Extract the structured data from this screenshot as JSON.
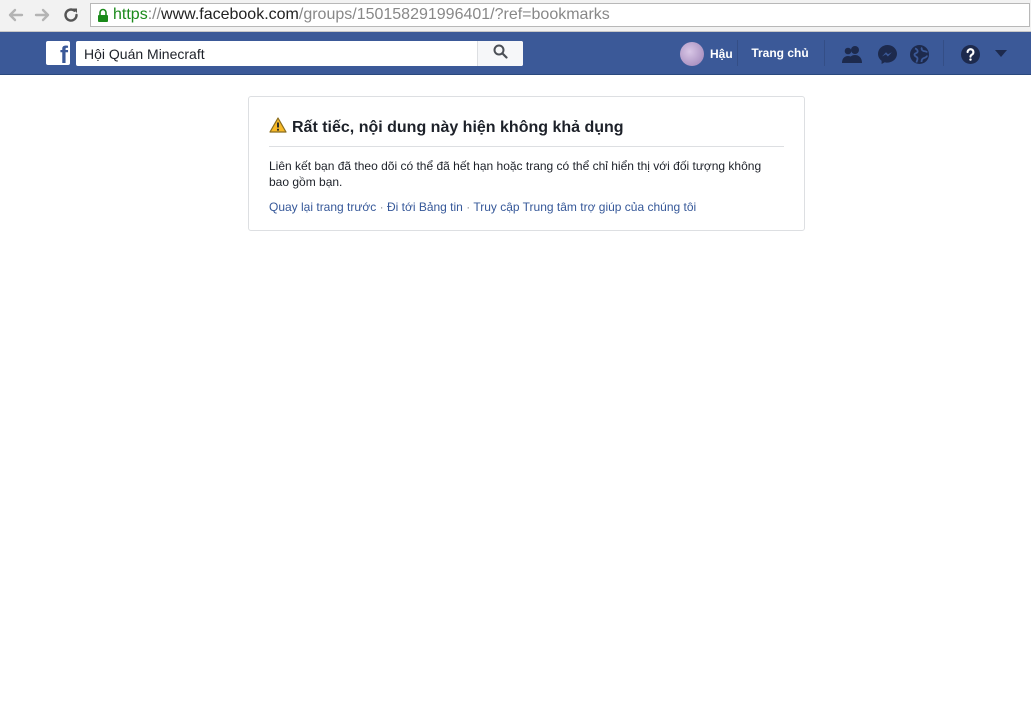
{
  "browser": {
    "url_scheme": "https",
    "url_separator": "://",
    "url_host": "www.facebook.com",
    "url_path": "/groups/150158291996401/?ref=bookmarks"
  },
  "header": {
    "search_value": "Hội Quán Minecraft",
    "profile_name": "Hậu",
    "home_label": "Trang chủ"
  },
  "error": {
    "title": "Rất tiếc, nội dung này hiện không khả dụng",
    "message": "Liên kết bạn đã theo dõi có thể đã hết hạn hoặc trang có thể chỉ hiển thị với đối tượng không bao gồm bạn.",
    "links": {
      "back": "Quay lại trang trước",
      "separator": " · ",
      "newsfeed": "Đi tới Bảng tin",
      "help": "Truy cập Trung tâm trợ giúp của chúng tôi"
    }
  },
  "colors": {
    "brand_blue": "#3b5998",
    "link": "#365899",
    "warning": "#f7b928"
  }
}
